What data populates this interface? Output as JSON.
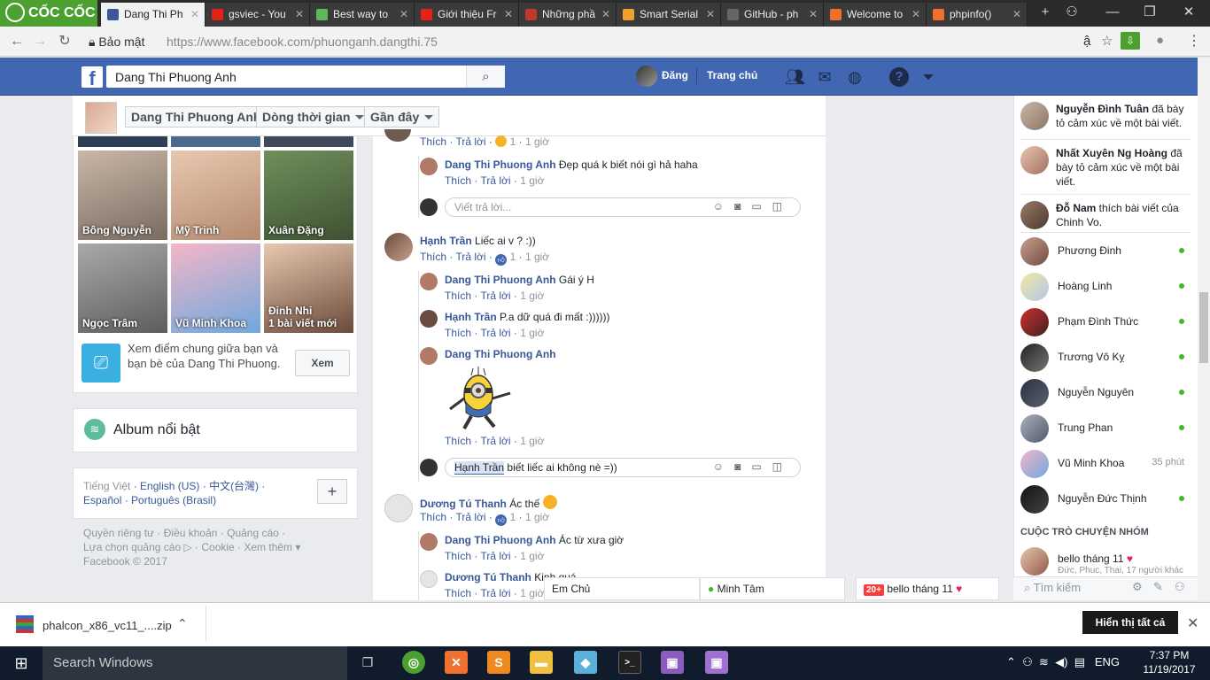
{
  "browser": {
    "brand": "CỐC CỐC",
    "tabs": [
      {
        "title": "Dang Thi Ph",
        "color": "#3b5998"
      },
      {
        "title": "gsviec - You",
        "color": "#e62117"
      },
      {
        "title": "Best way to",
        "color": "#5cb85c"
      },
      {
        "title": "Giới thiệu Fr",
        "color": "#e62117"
      },
      {
        "title": "Những phầ",
        "color": "#c0392b"
      },
      {
        "title": "Smart Serial",
        "color": "#f0a030"
      },
      {
        "title": "GitHub - ph",
        "color": "#666666"
      },
      {
        "title": "Welcome to",
        "color": "#f07030"
      },
      {
        "title": "phpinfo()",
        "color": "#f07030"
      }
    ],
    "security": "Bảo mật",
    "url_host": "https://www.facebook.com/",
    "url_path": "phuonganh.dangthi.75",
    "translate_glyph": "ậ"
  },
  "fb": {
    "search_value": "Dang Thi Phuong Anh",
    "nav_user": "Đăng",
    "nav_home": "Trang chủ",
    "profile_name": "Dang Thi Phuong Anh",
    "timeline": "Dòng thời gian",
    "recent": "Gần đây"
  },
  "friends": [
    {
      "name": "Bông Nguyễn",
      "bg": "linear-gradient(160deg,#c9b8a8,#7a6b60)"
    },
    {
      "name": "Mỹ Trinh",
      "bg": "linear-gradient(160deg,#e7c9b0,#b58a70)"
    },
    {
      "name": "Xuân Đặng",
      "bg": "linear-gradient(160deg,#6f8f5c,#3e5233)"
    },
    {
      "name": "Ngọc Trâm",
      "bg": "linear-gradient(160deg,#a9a9a9,#5d5d5d)"
    },
    {
      "name": "Vũ Minh Khoa",
      "bg": "linear-gradient(160deg,#f4b6c8,#6fa8dc)"
    },
    {
      "name": "Đinh Nhi",
      "bg": "linear-gradient(160deg,#e8c8b0,#6b4a3a)",
      "sub": "1 bài viết mới"
    }
  ],
  "mutual": {
    "text": "Xem điểm chung giữa bạn và bạn bè của Dang Thi Phuong.",
    "button": "Xem"
  },
  "album_title": "Album nổi bật",
  "languages": {
    "current": "Tiếng Việt",
    "others": "English (US) · 中文(台灣) · Español · Português (Brasil)"
  },
  "footer": {
    "line1": "Quyền riêng tư · Điều khoản · Quảng cáo ·",
    "line2": "Lựa chọn quảng cáo ▷ · Cookie · Xem thêm ▾",
    "line3": "Facebook © 2017"
  },
  "feed": {
    "like": "Thích",
    "reply": "Trả lời",
    "time": "1 giờ",
    "count": "1",
    "reply_placeholder": "Viết trả lời...",
    "c1_name": "Dang Thi Phuong Anh",
    "c1_text": "Đẹp quá k biết nói gì hả haha",
    "c2_name": "Hạnh Trần",
    "c2_text": "Liếc ai v ? :))",
    "c3_name": "Dang Thi Phuong Anh",
    "c3_text": "Gái ý H",
    "c4_name": "Hạnh Trần",
    "c4_text": "P.a dữ quá đi mất :))))))",
    "c5_name": "Dang Thi Phuong Anh",
    "typing_mention": "Hạnh Trần",
    "typing_text": "biết liếc ai không nè =))",
    "c6_name": "Dương Tú Thanh",
    "c6_text": "Ác thế",
    "c7_name": "Dang Thi Phuong Anh",
    "c7_text": "Ác từ xưa giờ",
    "c8_name": "Dương Tú Thanh",
    "c8_text": "Kinh quá"
  },
  "ticker": [
    {
      "name": "Nguyễn Đình Tuân",
      "text": " đã bày tỏ cảm xúc về một bài viết."
    },
    {
      "name": "Nhất Xuyên Ng Hoàng",
      "text": " đã bày tỏ cảm xúc về một bài viết."
    },
    {
      "name": "Đỗ Nam",
      "text": " thích bài viết của Chinh Vo."
    }
  ],
  "contacts": [
    {
      "name": "Phương Đinh",
      "online": true
    },
    {
      "name": "Hoàng Linh",
      "online": true
    },
    {
      "name": "Phạm Đình Thức",
      "online": true
    },
    {
      "name": "Trương Vô Kỵ",
      "online": true
    },
    {
      "name": "Nguyễn Nguyên",
      "online": true
    },
    {
      "name": "Trung Phan",
      "online": true
    },
    {
      "name": "Vũ Minh Khoa",
      "online": false,
      "ago": "35 phút"
    },
    {
      "name": "Nguyễn Đức Thịnh",
      "online": true
    }
  ],
  "group_header": "CUỘC TRÒ CHUYỆN NHÓM",
  "group": {
    "name": "bello tháng 11",
    "members": "Đức, Phuc, Thai, 17 người khác"
  },
  "chat_search": "Tìm kiếm",
  "chat_tabs": {
    "t1": "Em Chủ",
    "t2": "Minh Tâm",
    "t3_badge": "20+",
    "t3": "bello tháng 11"
  },
  "download": {
    "file": "phalcon_x86_vc11_....zip",
    "show_all": "Hiển thị tất cả"
  },
  "taskbar": {
    "search": "Search Windows",
    "lang": "ENG",
    "time": "7:37 PM",
    "date": "11/19/2017"
  }
}
